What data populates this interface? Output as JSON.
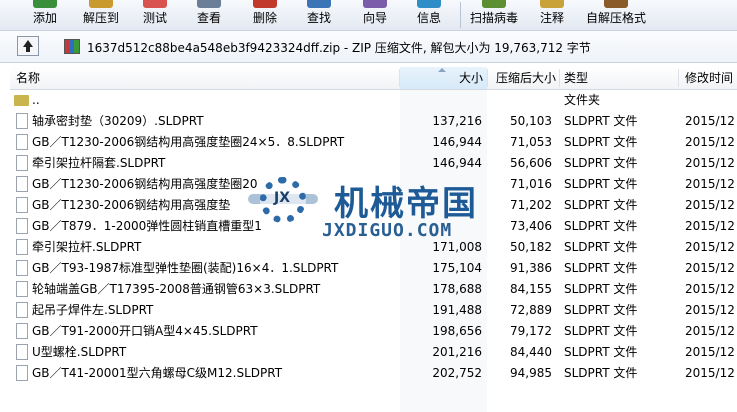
{
  "toolbar": {
    "buttons": [
      {
        "label": "添加",
        "color": "#3a8f3a"
      },
      {
        "label": "解压到",
        "color": "#c99a2e"
      },
      {
        "label": "测试",
        "color": "#d9534f"
      },
      {
        "label": "查看",
        "color": "#6b7f99"
      },
      {
        "label": "删除",
        "color": "#c0392b"
      },
      {
        "label": "查找",
        "color": "#3c74b8"
      },
      {
        "label": "向导",
        "color": "#7a5cab"
      },
      {
        "label": "信息",
        "color": "#2f8dc8"
      },
      {
        "label": "扫描病毒",
        "color": "#5b8f2f"
      },
      {
        "label": "注释",
        "color": "#c9a33a"
      },
      {
        "label": "自解压格式",
        "color": "#8a5a2b"
      }
    ]
  },
  "address": {
    "text": "1637d512c88be4a548eb3f9423324dff.zip - ZIP 压缩文件, 解包大小为 19,763,712 字节"
  },
  "columns": {
    "name": "名称",
    "size": "大小",
    "packed": "压缩后大小",
    "type": "类型",
    "modified": "修改时间"
  },
  "rows": [
    {
      "name": "..",
      "size": "",
      "packed": "",
      "type": "文件夹",
      "modified": "",
      "folder": true
    },
    {
      "name": "轴承密封垫（30209）.SLDPRT",
      "size": "137,216",
      "packed": "50,103",
      "type": "SLDPRT 文件",
      "modified": "2015/12"
    },
    {
      "name": "GB／T1230-2006钢结构用高强度垫圈24×5．8.SLDPRT",
      "size": "146,944",
      "packed": "71,053",
      "type": "SLDPRT 文件",
      "modified": "2015/12"
    },
    {
      "name": "牵引架拉杆隔套.SLDPRT",
      "size": "146,944",
      "packed": "56,606",
      "type": "SLDPRT 文件",
      "modified": "2015/12"
    },
    {
      "name": "GB／T1230-2006钢结构用高强度垫圈20",
      "size": "",
      "packed": "71,016",
      "type": "SLDPRT 文件",
      "modified": "2015/12"
    },
    {
      "name": "GB／T1230-2006钢结构用高强度垫",
      "size": "",
      "packed": "71,202",
      "type": "SLDPRT 文件",
      "modified": "2015/12"
    },
    {
      "name": "GB／T879．1-2000弹性圆柱销直槽重型1",
      "size": "",
      "packed": "73,406",
      "type": "SLDPRT 文件",
      "modified": "2015/12"
    },
    {
      "name": "牵引架拉杆.SLDPRT",
      "size": "171,008",
      "packed": "50,182",
      "type": "SLDPRT 文件",
      "modified": "2015/12"
    },
    {
      "name": "GB／T93-1987标准型弹性垫圈(装配)16×4．1.SLDPRT",
      "size": "175,104",
      "packed": "91,386",
      "type": "SLDPRT 文件",
      "modified": "2015/12"
    },
    {
      "name": "轮轴端盖GB／T17395-2008普通钢管63×3.SLDPRT",
      "size": "178,688",
      "packed": "84,155",
      "type": "SLDPRT 文件",
      "modified": "2015/12"
    },
    {
      "name": "起吊子焊件左.SLDPRT",
      "size": "191,488",
      "packed": "72,889",
      "type": "SLDPRT 文件",
      "modified": "2015/12"
    },
    {
      "name": "GB／T91-2000开口销A型4×45.SLDPRT",
      "size": "198,656",
      "packed": "79,172",
      "type": "SLDPRT 文件",
      "modified": "2015/12"
    },
    {
      "name": "U型螺栓.SLDPRT",
      "size": "201,216",
      "packed": "84,440",
      "type": "SLDPRT 文件",
      "modified": "2015/12"
    },
    {
      "name": "GB／T41-20001型六角螺母C级M12.SLDPRT",
      "size": "202,752",
      "packed": "94,985",
      "type": "SLDPRT 文件",
      "modified": "2015/12"
    }
  ],
  "watermark": {
    "title": "机械帝国",
    "subtitle": "JXDIGUO.COM",
    "badge": "JX"
  }
}
